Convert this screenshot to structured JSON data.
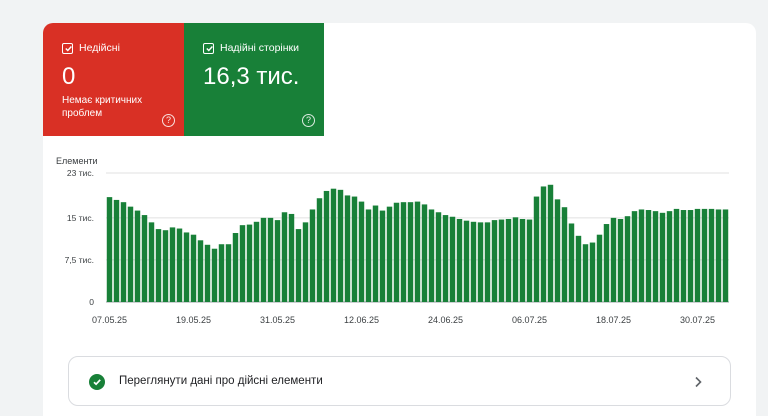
{
  "tiles": {
    "invalid": {
      "label": "Недійсні",
      "value": "0",
      "sub": "Немає критичних проблем",
      "color": "#d93025",
      "help_icon": "help-icon"
    },
    "valid": {
      "label": "Надійні сторінки",
      "value": "16,3 тис.",
      "color": "#188038",
      "help_icon": "help-icon"
    }
  },
  "chart_data": {
    "type": "bar",
    "ylabel": "Елементи",
    "ylim": [
      0,
      23000
    ],
    "yticks": [
      {
        "value": 23000,
        "label": "23 тис."
      },
      {
        "value": 15000,
        "label": "15 тис."
      },
      {
        "value": 7500,
        "label": "7,5 тис."
      },
      {
        "value": 0,
        "label": "0"
      }
    ],
    "xticks": [
      {
        "index": 0,
        "label": "07.05.25"
      },
      {
        "index": 12,
        "label": "19.05.25"
      },
      {
        "index": 24,
        "label": "31.05.25"
      },
      {
        "index": 36,
        "label": "12.06.25"
      },
      {
        "index": 48,
        "label": "24.06.25"
      },
      {
        "index": 60,
        "label": "06.07.25"
      },
      {
        "index": 72,
        "label": "18.07.25"
      },
      {
        "index": 84,
        "label": "30.07.25"
      }
    ],
    "color": "#188038",
    "values": [
      18700,
      18200,
      17800,
      17000,
      16300,
      15500,
      14200,
      13000,
      12800,
      13300,
      13100,
      12400,
      12000,
      11000,
      10200,
      9500,
      10300,
      10300,
      12300,
      13700,
      13800,
      14300,
      15000,
      15000,
      14600,
      16000,
      15700,
      13000,
      14200,
      16500,
      18500,
      19800,
      20200,
      20000,
      19000,
      18800,
      17900,
      16500,
      17200,
      16300,
      17000,
      17700,
      17800,
      17800,
      17900,
      17400,
      16500,
      16000,
      15500,
      15200,
      14800,
      14500,
      14300,
      14200,
      14200,
      14600,
      14700,
      14800,
      15100,
      14800,
      14700,
      18800,
      20600,
      20900,
      18300,
      16900,
      14000,
      11800,
      10300,
      10600,
      12000,
      13900,
      15000,
      14800,
      15300,
      16200,
      16500,
      16400,
      16200,
      15900,
      16200,
      16600,
      16400,
      16400,
      16600,
      16600,
      16600,
      16500,
      16500
    ]
  },
  "footer_row": {
    "label": "Переглянути дані про дійсні елементи",
    "icon": "check-circle-icon",
    "chevron": "chevron-right-icon"
  }
}
